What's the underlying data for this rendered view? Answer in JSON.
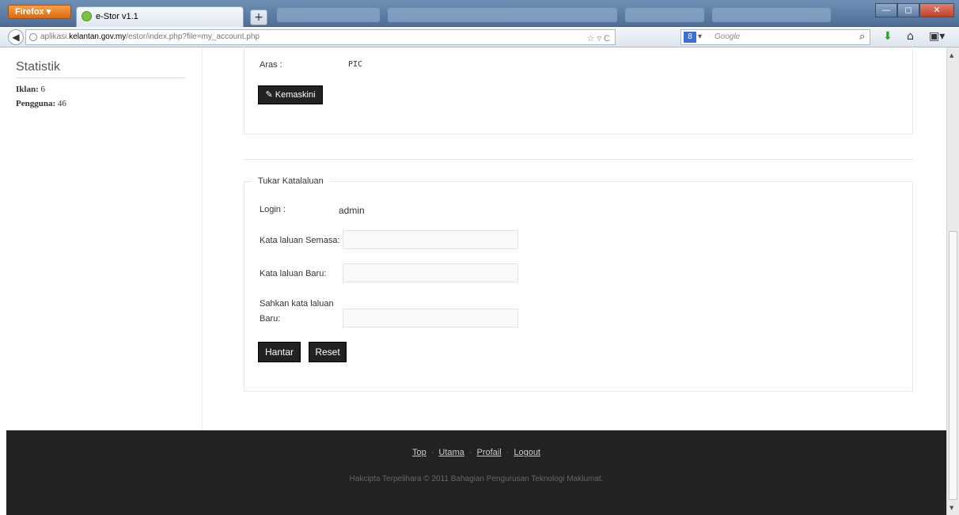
{
  "browser": {
    "menu_button": "Firefox ▾",
    "tab_title": "e-Stor v1.1",
    "new_tab": "+",
    "url_prefix": "aplikasi.",
    "url_domain": "kelantan.gov.my",
    "url_path": "/estor/index.php?file=my_account.php",
    "url_controls": "☆ ▿ C",
    "search_placeholder": "Google",
    "search_engine_icon": "g-search-icon",
    "window_minimize": "—",
    "window_restore": "◻",
    "window_close": "✕"
  },
  "sidebar": {
    "title": "Statistik",
    "stats": [
      {
        "label": "Iklan:",
        "value": "6"
      },
      {
        "label": "Pengguna:",
        "value": "46"
      }
    ]
  },
  "profile": {
    "level_label": "Aras :",
    "level_value": "PIC",
    "update_button": "Kemaskini"
  },
  "password_form": {
    "legend": "Tukar Katalaluan",
    "login_label": "Login :",
    "login_value": "admin",
    "current_label": "Kata laluan Semasa:",
    "new_label": "Kata laluan Baru:",
    "confirm_label_line1": "Sahkan kata laluan",
    "confirm_label_line2": "Baru:",
    "submit_button": "Hantar",
    "reset_button": "Reset"
  },
  "footer": {
    "links": [
      "Top",
      "Utama",
      "Profail",
      "Logout"
    ],
    "copyright": "Hakcipta Terpelihara © 2011 Bahagian Pengurusan Teknologi Maklumat."
  }
}
